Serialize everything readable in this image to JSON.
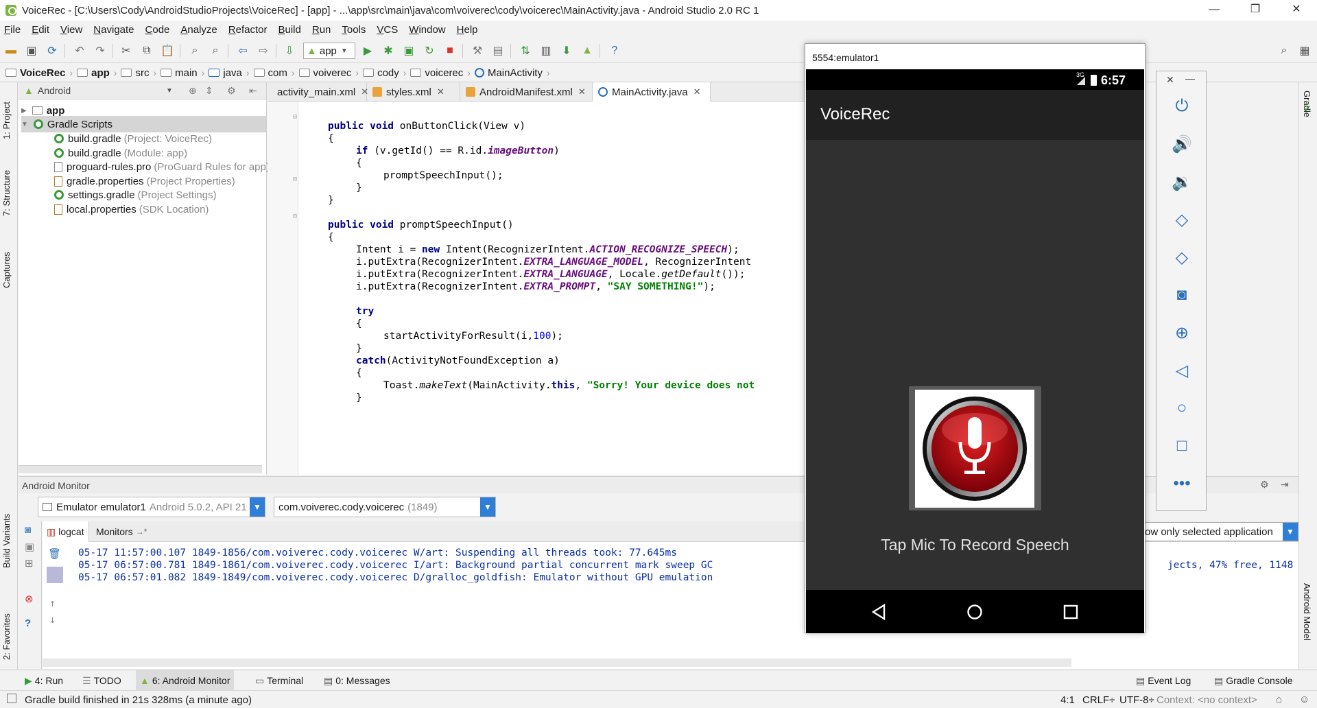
{
  "window": {
    "title": "VoiceRec - [C:\\Users\\Cody\\AndroidStudioProjects\\VoiceRec] - [app] - ...\\app\\src\\main\\java\\com\\voiverec\\cody\\voicerec\\MainActivity.java - Android Studio 2.0 RC 1",
    "minimize": "—",
    "restore": "❐",
    "close": "✕"
  },
  "menu": [
    "File",
    "Edit",
    "View",
    "Navigate",
    "Code",
    "Analyze",
    "Refactor",
    "Build",
    "Run",
    "Tools",
    "VCS",
    "Window",
    "Help"
  ],
  "toolbar": {
    "run_config": "app"
  },
  "breadcrumb": [
    "VoiceRec",
    "app",
    "src",
    "main",
    "java",
    "com",
    "voiverec",
    "cody",
    "voicerec",
    "MainActivity"
  ],
  "project_panel": {
    "view_mode": "Android",
    "tree": [
      {
        "label": "app",
        "hint": ""
      },
      {
        "label": "Gradle Scripts",
        "hint": ""
      },
      {
        "label": "build.gradle",
        "hint": "(Project: VoiceRec)"
      },
      {
        "label": "build.gradle",
        "hint": "(Module: app)"
      },
      {
        "label": "proguard-rules.pro",
        "hint": "(ProGuard Rules for app)"
      },
      {
        "label": "gradle.properties",
        "hint": "(Project Properties)"
      },
      {
        "label": "settings.gradle",
        "hint": "(Project Settings)"
      },
      {
        "label": "local.properties",
        "hint": "(SDK Location)"
      }
    ]
  },
  "left_tool_tabs": [
    "1: Project",
    "7: Structure",
    "Captures",
    "Build Variants",
    "2: Favorites"
  ],
  "right_tool_tabs": [
    "Gradle",
    "Android Model"
  ],
  "editor_tabs": [
    {
      "label": "activity_main.xml",
      "active": false
    },
    {
      "label": "styles.xml",
      "active": false
    },
    {
      "label": "AndroidManifest.xml",
      "active": false
    },
    {
      "label": "MainActivity.java",
      "active": true
    }
  ],
  "code": {
    "l1a": "public void",
    "l1b": " onButtonClick(View v)",
    "l2": "{",
    "l3a": "if",
    "l3b": " (v.getId() == R.id.",
    "l3c": "imageButton",
    "l3d": ")",
    "l4": "{",
    "l5": "promptSpeechInput();",
    "l6": "}",
    "l7": "}",
    "l8a": "public void",
    "l8b": " promptSpeechInput()",
    "l9": "{",
    "l10a": "Intent i = ",
    "l10b": "new",
    "l10c": " Intent(RecognizerIntent.",
    "l10d": "ACTION_RECOGNIZE_SPEECH",
    "l10e": ");",
    "l11a": "i.putExtra(RecognizerIntent.",
    "l11b": "EXTRA_LANGUAGE_MODEL",
    "l11c": ", RecognizerIntent",
    "l12a": "i.putExtra(RecognizerIntent.",
    "l12b": "EXTRA_LANGUAGE",
    "l12c": ", Locale.",
    "l12d": "getDefault",
    "l12e": "());",
    "l13a": "i.putExtra(RecognizerIntent.",
    "l13b": "EXTRA_PROMPT",
    "l13c": ", ",
    "l13d": "\"SAY SOMETHING!\"",
    "l13e": ");",
    "l14": "try",
    "l15": "{",
    "l16a": "startActivityForResult(i,",
    "l16b": "100",
    "l16c": ");",
    "l17": "}",
    "l18a": "catch",
    "l18b": "(ActivityNotFoundException a)",
    "l19": "{",
    "l20a": "Toast.",
    "l20b": "makeText",
    "l20c": "(MainActivity.",
    "l20d": "this",
    "l20e": ", ",
    "l20f": "\"Sorry! Your device does not",
    "l21": "}"
  },
  "monitor": {
    "title": "Android Monitor",
    "device": "Emulator emulator1",
    "device_detail": "Android 5.0.2, API 21",
    "process": "com.voiverec.cody.voicerec",
    "process_bold": "voicerec",
    "process_pid": "(1849)",
    "tabs": [
      "logcat",
      "Monitors"
    ],
    "filter": "ow only selected application",
    "log": [
      "05-17 11:57:00.107 1849-1856/com.voiverec.cody.voicerec W/art: Suspending all threads took: 77.645ms",
      "05-17 06:57:00.781 1849-1861/com.voiverec.cody.voicerec I/art: Background partial concurrent mark sweep GC",
      "05-17 06:57:01.082 1849-1849/com.voiverec.cody.voicerec D/gralloc_goldfish: Emulator without GPU emulation"
    ],
    "log_overflow": [
      "jects, 47% free, 1148"
    ]
  },
  "bottom_tabs": [
    {
      "label": "4: Run",
      "active": false
    },
    {
      "label": "TODO",
      "active": false
    },
    {
      "label": "6: Android Monitor",
      "active": true
    },
    {
      "label": "Terminal",
      "active": false
    },
    {
      "label": "0: Messages",
      "active": false
    }
  ],
  "bottom_right_tabs": [
    "Event Log",
    "Gradle Console"
  ],
  "status": {
    "message": "Gradle build finished in 21s 328ms (a minute ago)",
    "position": "4:1",
    "line_sep": "CRLF÷",
    "encoding": "UTF-8÷",
    "context": "Context: <no context>"
  },
  "emulator": {
    "title": "5554:emulator1",
    "signal": "3G",
    "time": "6:57",
    "app_title": "VoiceRec",
    "hint": "Tap Mic To Record Speech",
    "colors": {
      "action_bar": "#212121",
      "background": "#303030",
      "mic_red": "#c0101a"
    }
  }
}
